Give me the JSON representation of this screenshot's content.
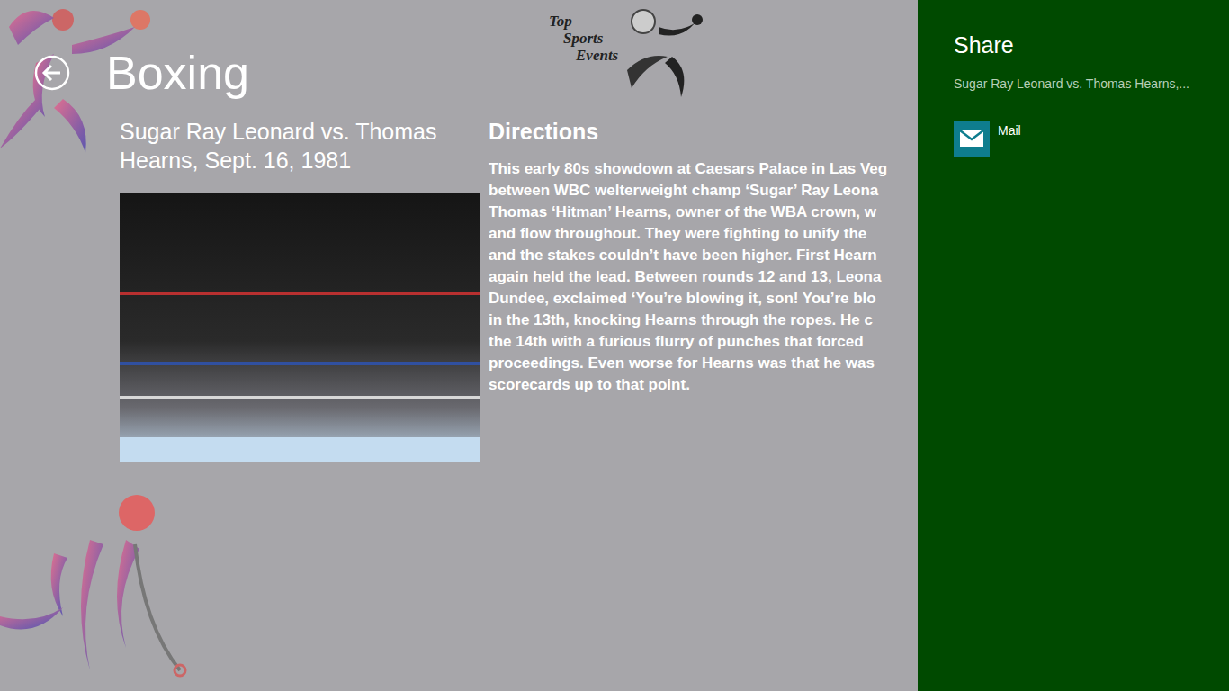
{
  "app": {
    "logo_lines": [
      "Top",
      "Sports",
      "Events"
    ]
  },
  "page_title": "Boxing",
  "event": {
    "title": "Sugar Ray Leonard vs. Thomas Hearns, Sept. 16, 1981",
    "section_heading": "Directions",
    "description_lines": [
      "This early 80s showdown at Caesars Palace in Las Veg",
      "between WBC welterweight champ ‘Sugar’ Ray Leona",
      "Thomas ‘Hitman’ Hearns, owner of the WBA crown, w",
      "and flow throughout. They were fighting to unify the",
      "and the stakes couldn’t have been higher. First Hearn",
      "again held the lead. Between rounds 12 and 13, Leona",
      "Dundee, exclaimed ‘You’re blowing it, son! You’re blo",
      "in the 13th, knocking Hearns through the ropes. He c",
      "the 14th with a furious flurry of punches that forced",
      "proceedings. Even worse for Hearns was that he was",
      "scorecards up to that point."
    ]
  },
  "share_pane": {
    "title": "Share",
    "subtitle": "Sugar Ray Leonard vs. Thomas Hearns,...",
    "targets": [
      {
        "label": "Mail"
      }
    ]
  }
}
